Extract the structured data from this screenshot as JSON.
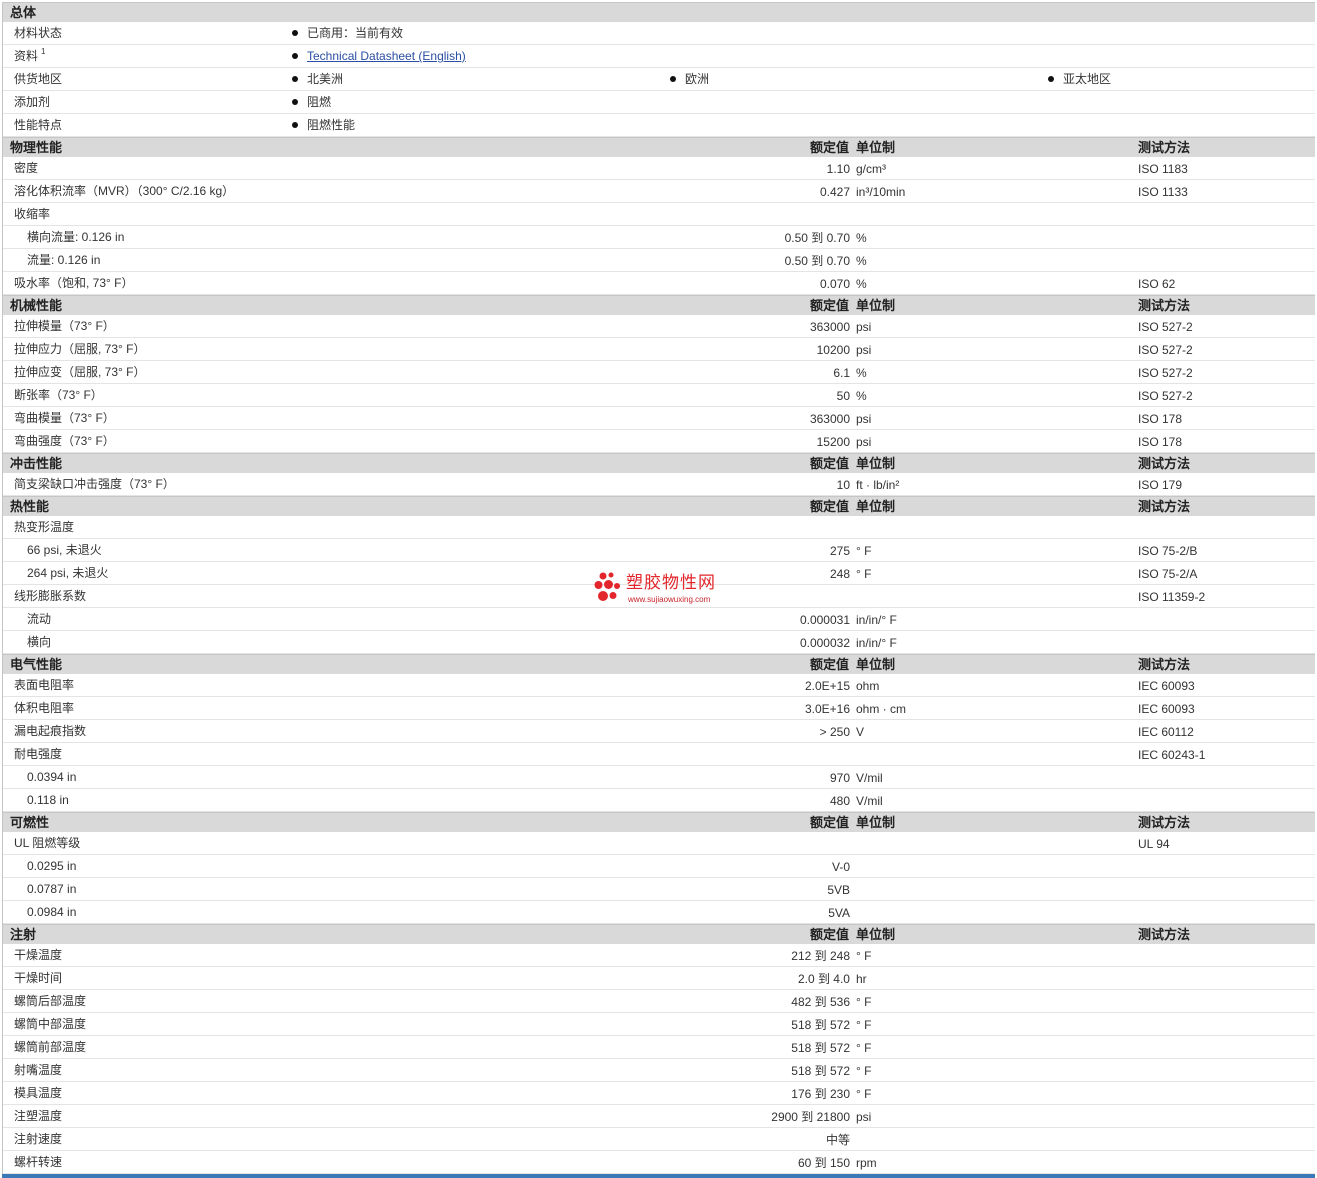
{
  "columns": {
    "value": "额定值",
    "unit": "单位制",
    "method": "测试方法"
  },
  "colors": {
    "header_bg": "#d9d9d9",
    "link": "#2a4ea3",
    "bottom_bar": "#3a78b8",
    "watermark": "#e2262b"
  },
  "icons": {
    "bullet": "bullet-icon",
    "watermark_logo": "red-dots-logo-icon"
  },
  "watermark": {
    "name": "塑胶物性网",
    "url": "www.sujiaowuxing.com"
  },
  "sections": [
    {
      "title": "总体",
      "show_columns": false,
      "rows": [
        {
          "label": "材料状态",
          "items": [
            {
              "text": "已商用：当前有效"
            }
          ]
        },
        {
          "label": "资料",
          "sup": "1",
          "items": [
            {
              "text": "Technical Datasheet (English)",
              "link": true
            }
          ]
        },
        {
          "label": "供货地区",
          "items": [
            {
              "text": "北美洲"
            },
            {
              "text": "欧洲"
            },
            {
              "text": "亚太地区"
            }
          ]
        },
        {
          "label": "添加剂",
          "items": [
            {
              "text": "阻燃"
            }
          ]
        },
        {
          "label": "性能特点",
          "items": [
            {
              "text": "阻燃性能"
            }
          ]
        }
      ]
    },
    {
      "title": "物理性能",
      "show_columns": true,
      "rows": [
        {
          "label": "密度",
          "value": "1.10",
          "unit": "g/cm³",
          "method": "ISO 1183"
        },
        {
          "label": "溶化体积流率（MVR）（300° C/2.16 kg）",
          "value": "0.427",
          "unit": "in³/10min",
          "method": "ISO 1133"
        },
        {
          "label": "收缩率"
        },
        {
          "label": "横向流量: 0.126 in",
          "indent": true,
          "value": "0.50 到 0.70",
          "unit": "%"
        },
        {
          "label": "流量: 0.126 in",
          "indent": true,
          "value": "0.50 到 0.70",
          "unit": "%"
        },
        {
          "label": "吸水率（饱和, 73° F）",
          "value": "0.070",
          "unit": "%",
          "method": "ISO 62"
        }
      ]
    },
    {
      "title": "机械性能",
      "show_columns": true,
      "rows": [
        {
          "label": "拉伸模量（73° F）",
          "value": "363000",
          "unit": "psi",
          "method": "ISO 527-2"
        },
        {
          "label": "拉伸应力（屈服, 73° F）",
          "value": "10200",
          "unit": "psi",
          "method": "ISO 527-2"
        },
        {
          "label": "拉伸应变（屈服, 73° F）",
          "value": "6.1",
          "unit": "%",
          "method": "ISO 527-2"
        },
        {
          "label": "断张率（73° F）",
          "value": "50",
          "unit": "%",
          "method": "ISO 527-2"
        },
        {
          "label": "弯曲模量（73° F）",
          "value": "363000",
          "unit": "psi",
          "method": "ISO 178"
        },
        {
          "label": "弯曲强度（73° F）",
          "value": "15200",
          "unit": "psi",
          "method": "ISO 178"
        }
      ]
    },
    {
      "title": "冲击性能",
      "show_columns": true,
      "rows": [
        {
          "label": "简支梁缺口冲击强度（73° F）",
          "value": "10",
          "unit": "ft · lb/in²",
          "method": "ISO 179"
        }
      ]
    },
    {
      "title": "热性能",
      "show_columns": true,
      "rows": [
        {
          "label": "热变形温度"
        },
        {
          "label": "66 psi, 未退火",
          "indent": true,
          "value": "275",
          "unit": "° F",
          "method": "ISO 75-2/B"
        },
        {
          "label": "264 psi, 未退火",
          "indent": true,
          "value": "248",
          "unit": "° F",
          "method": "ISO 75-2/A"
        },
        {
          "label": "线形膨胀系数",
          "method": "ISO 11359-2"
        },
        {
          "label": "流动",
          "indent": true,
          "value": "0.000031",
          "unit": "in/in/° F"
        },
        {
          "label": "横向",
          "indent": true,
          "value": "0.000032",
          "unit": "in/in/° F"
        }
      ]
    },
    {
      "title": "电气性能",
      "show_columns": true,
      "rows": [
        {
          "label": "表面电阻率",
          "value": "2.0E+15",
          "unit": "ohm",
          "method": "IEC 60093"
        },
        {
          "label": "体积电阻率",
          "value": "3.0E+16",
          "unit": "ohm · cm",
          "method": "IEC 60093"
        },
        {
          "label": "漏电起痕指数",
          "value": "> 250",
          "unit": "V",
          "method": "IEC 60112"
        },
        {
          "label": "耐电强度",
          "method": "IEC 60243-1"
        },
        {
          "label": "0.0394 in",
          "indent": true,
          "value": "970",
          "unit": "V/mil"
        },
        {
          "label": "0.118 in",
          "indent": true,
          "value": "480",
          "unit": "V/mil"
        }
      ]
    },
    {
      "title": "可燃性",
      "show_columns": true,
      "rows": [
        {
          "label": "UL 阻燃等级",
          "method": "UL 94"
        },
        {
          "label": "0.0295 in",
          "indent": true,
          "value": "V-0"
        },
        {
          "label": "0.0787 in",
          "indent": true,
          "value": "5VB"
        },
        {
          "label": "0.0984 in",
          "indent": true,
          "value": "5VA"
        }
      ]
    },
    {
      "title": "注射",
      "show_columns": true,
      "rows": [
        {
          "label": "干燥温度",
          "value": "212 到 248",
          "unit": "° F"
        },
        {
          "label": "干燥时间",
          "value": "2.0 到 4.0",
          "unit": "hr"
        },
        {
          "label": "螺筒后部温度",
          "value": "482 到 536",
          "unit": "° F"
        },
        {
          "label": "螺筒中部温度",
          "value": "518 到 572",
          "unit": "° F"
        },
        {
          "label": "螺筒前部温度",
          "value": "518 到 572",
          "unit": "° F"
        },
        {
          "label": "射嘴温度",
          "value": "518 到 572",
          "unit": "° F"
        },
        {
          "label": "模具温度",
          "value": "176 到 230",
          "unit": "° F"
        },
        {
          "label": "注塑温度",
          "value": "2900 到 21800",
          "unit": "psi"
        },
        {
          "label": "注射速度",
          "value": "中等"
        },
        {
          "label": "螺杆转速",
          "value": "60 到 150",
          "unit": "rpm"
        }
      ]
    }
  ]
}
